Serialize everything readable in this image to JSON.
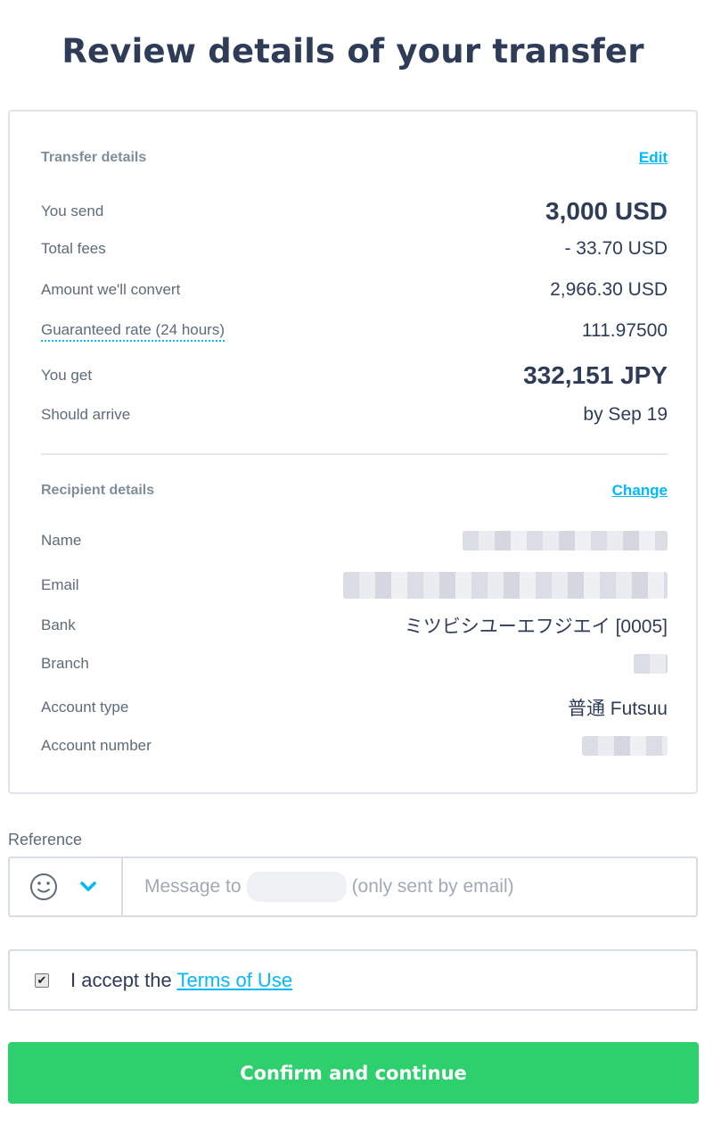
{
  "title": "Review details of your transfer",
  "transfer": {
    "heading": "Transfer details",
    "edit_label": "Edit",
    "rows": [
      {
        "label": "You send",
        "value": "3,000 USD"
      },
      {
        "label": "Total fees",
        "value": "- 33.70 USD"
      },
      {
        "label": "Amount we'll convert",
        "value": "2,966.30 USD"
      },
      {
        "label": "Guaranteed rate (24 hours)",
        "value": "111.97500"
      },
      {
        "label": "You get",
        "value": "332,151 JPY"
      },
      {
        "label": "Should arrive",
        "value": "by Sep 19"
      }
    ]
  },
  "recipient": {
    "heading": "Recipient details",
    "change_label": "Change",
    "rows": [
      {
        "label": "Name",
        "value": ""
      },
      {
        "label": "Email",
        "value": ""
      },
      {
        "label": "Bank",
        "value": "ミツビシユーエフジエイ [0005]"
      },
      {
        "label": "Branch",
        "value": ""
      },
      {
        "label": "Account type",
        "value": "普通 Futsuu"
      },
      {
        "label": "Account number",
        "value": ""
      }
    ]
  },
  "reference": {
    "label": "Reference",
    "placeholder_prefix": "Message to",
    "placeholder_suffix": "(only sent by email)"
  },
  "terms": {
    "prefix": "I accept the",
    "link": "Terms of Use",
    "checked": true
  },
  "confirm_label": "Confirm and continue",
  "colors": {
    "accent": "#00b9ff",
    "confirm": "#2ed06e",
    "text": "#2e3c57"
  }
}
